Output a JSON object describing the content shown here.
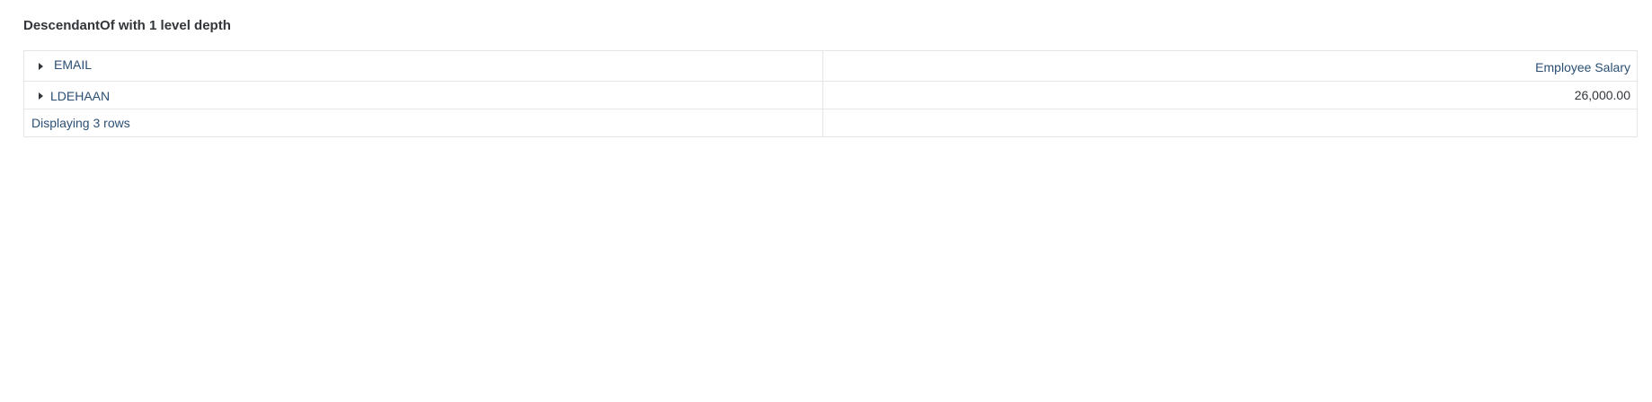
{
  "report": {
    "title": "DescendantOf with 1 level depth"
  },
  "grid": {
    "header": {
      "row_dimension": "EMAIL",
      "column_measure": "Employee Salary"
    },
    "rows": [
      {
        "member": "LDEHAAN",
        "value": "26,000.00"
      }
    ],
    "footer": {
      "status": "Displaying 3 rows"
    }
  }
}
